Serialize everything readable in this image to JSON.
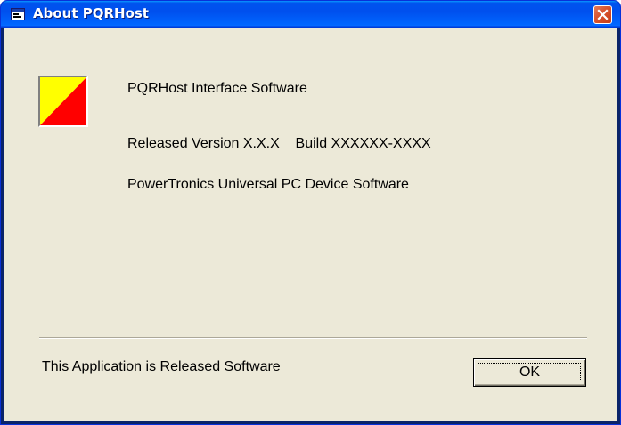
{
  "window": {
    "title": "About PQRHost"
  },
  "about": {
    "product_name": "PQRHost Interface Software",
    "version_line": "Released Version X.X.X    Build XXXXXX-XXXX",
    "company_line": "PowerTronics Universal PC Device Software",
    "release_status": "This Application is Released Software"
  },
  "buttons": {
    "ok_label": "OK"
  },
  "icons": {
    "title_icon": "app-window-icon",
    "close": "close-icon",
    "logo": "product-logo-icon"
  },
  "colors": {
    "logo_yellow": "#ffff00",
    "logo_red": "#ff0000",
    "dialog_face": "#ece9d8",
    "titlebar_blue": "#0053ee",
    "close_red": "#d8532e"
  }
}
